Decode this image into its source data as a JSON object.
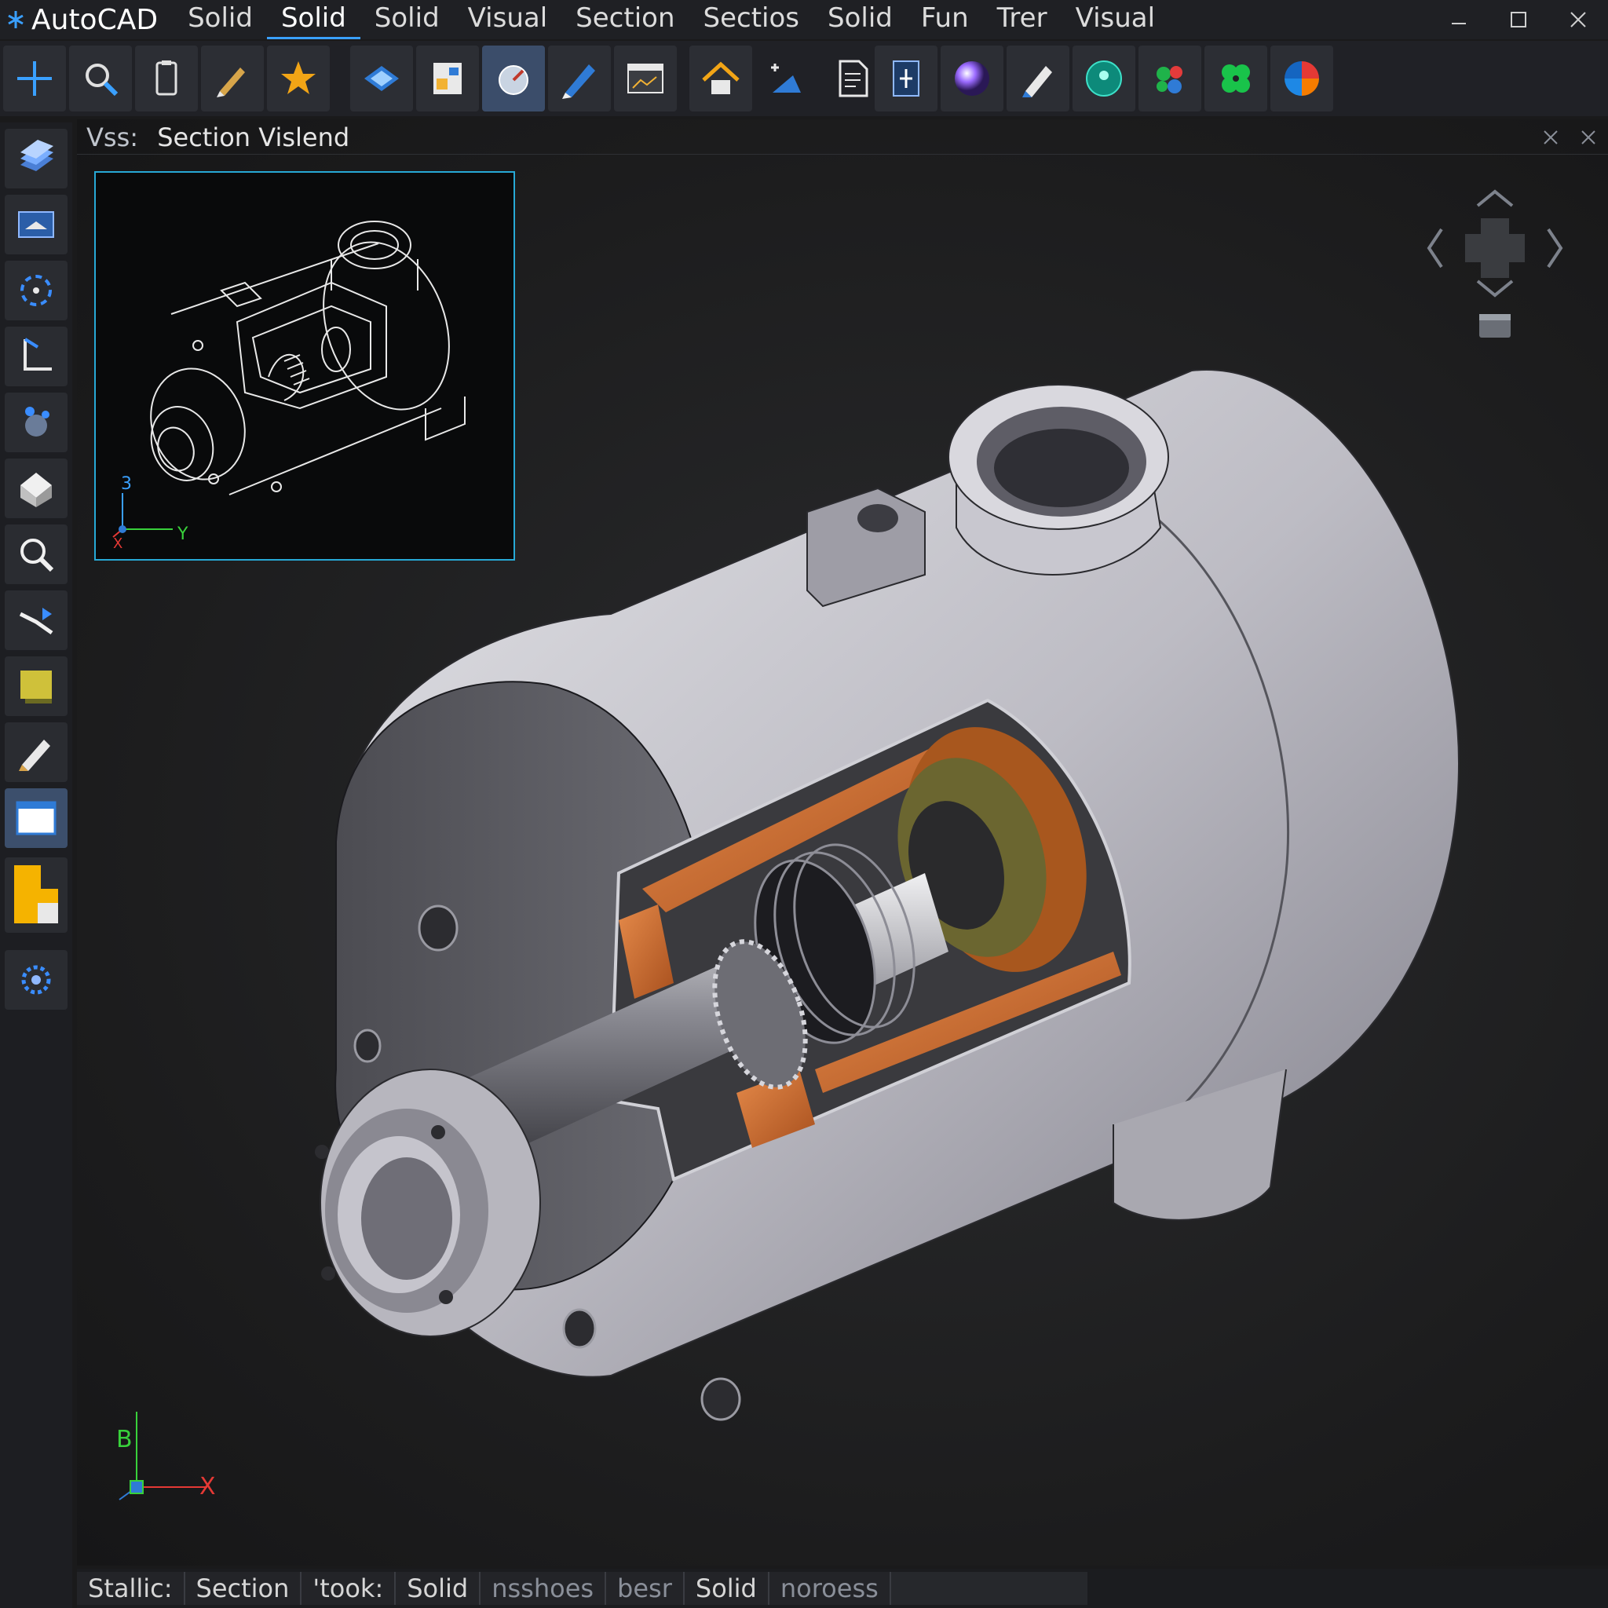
{
  "app": {
    "name": "AutoCAD"
  },
  "menu": {
    "items": [
      {
        "label": "Solid"
      },
      {
        "label": "Solid",
        "active": true
      },
      {
        "label": "Solid"
      },
      {
        "label": "Visual"
      },
      {
        "label": "Section"
      },
      {
        "label": "Sectios"
      },
      {
        "label": "Solid"
      },
      {
        "label": "Fun"
      },
      {
        "label": "Trer"
      },
      {
        "label": "Visual"
      }
    ]
  },
  "window_controls": [
    "minimize-icon",
    "maximize-icon",
    "close-icon"
  ],
  "ribbon": {
    "groups": [
      [
        "line-icon",
        "zoom-icon",
        "clipboard-icon",
        "pen-icon",
        "star-icon"
      ],
      [
        "section-plane-icon",
        "layout-icon",
        "gauge-icon",
        "pencil-icon",
        "window-icon"
      ],
      [
        "home-icon",
        "dimension-icon",
        "document-icon"
      ],
      [
        "sheet-icon",
        "sphere-icon",
        "pen-tool-icon",
        "globe-icon",
        "palette-icon",
        "clover-icon",
        "color-wheel-icon"
      ]
    ]
  },
  "left_toolbar": [
    "layers-icon",
    "view-cube-icon",
    "orbit-icon",
    "ucs-icon",
    "material-icon",
    "box-icon",
    "zoom-icon",
    "pan-icon",
    "render-icon",
    "edit-icon",
    "viewport-icon",
    "folder-icon",
    "settings-icon"
  ],
  "viewport": {
    "title_prefix": "Vss:",
    "title": "Section Vislend",
    "inset": {
      "axis_z": "3",
      "axis_x": "X",
      "axis_y": "Y"
    },
    "ucs": {
      "axis_b": "B",
      "axis_x": "X"
    }
  },
  "colors": {
    "accent": "#3aa0ff",
    "inset_border": "#27a9d6",
    "copper": "#c9662a",
    "body_gray": "#c8c8cc"
  },
  "statusbar": {
    "items": [
      {
        "label": "Stallic:"
      },
      {
        "label": "Section"
      },
      {
        "label": "'took:"
      },
      {
        "label": "Solid"
      },
      {
        "label": "nsshoes",
        "dim": true
      },
      {
        "label": "besr",
        "dim": true
      },
      {
        "label": "Solid"
      },
      {
        "label": "noroess",
        "dim": true
      }
    ]
  }
}
